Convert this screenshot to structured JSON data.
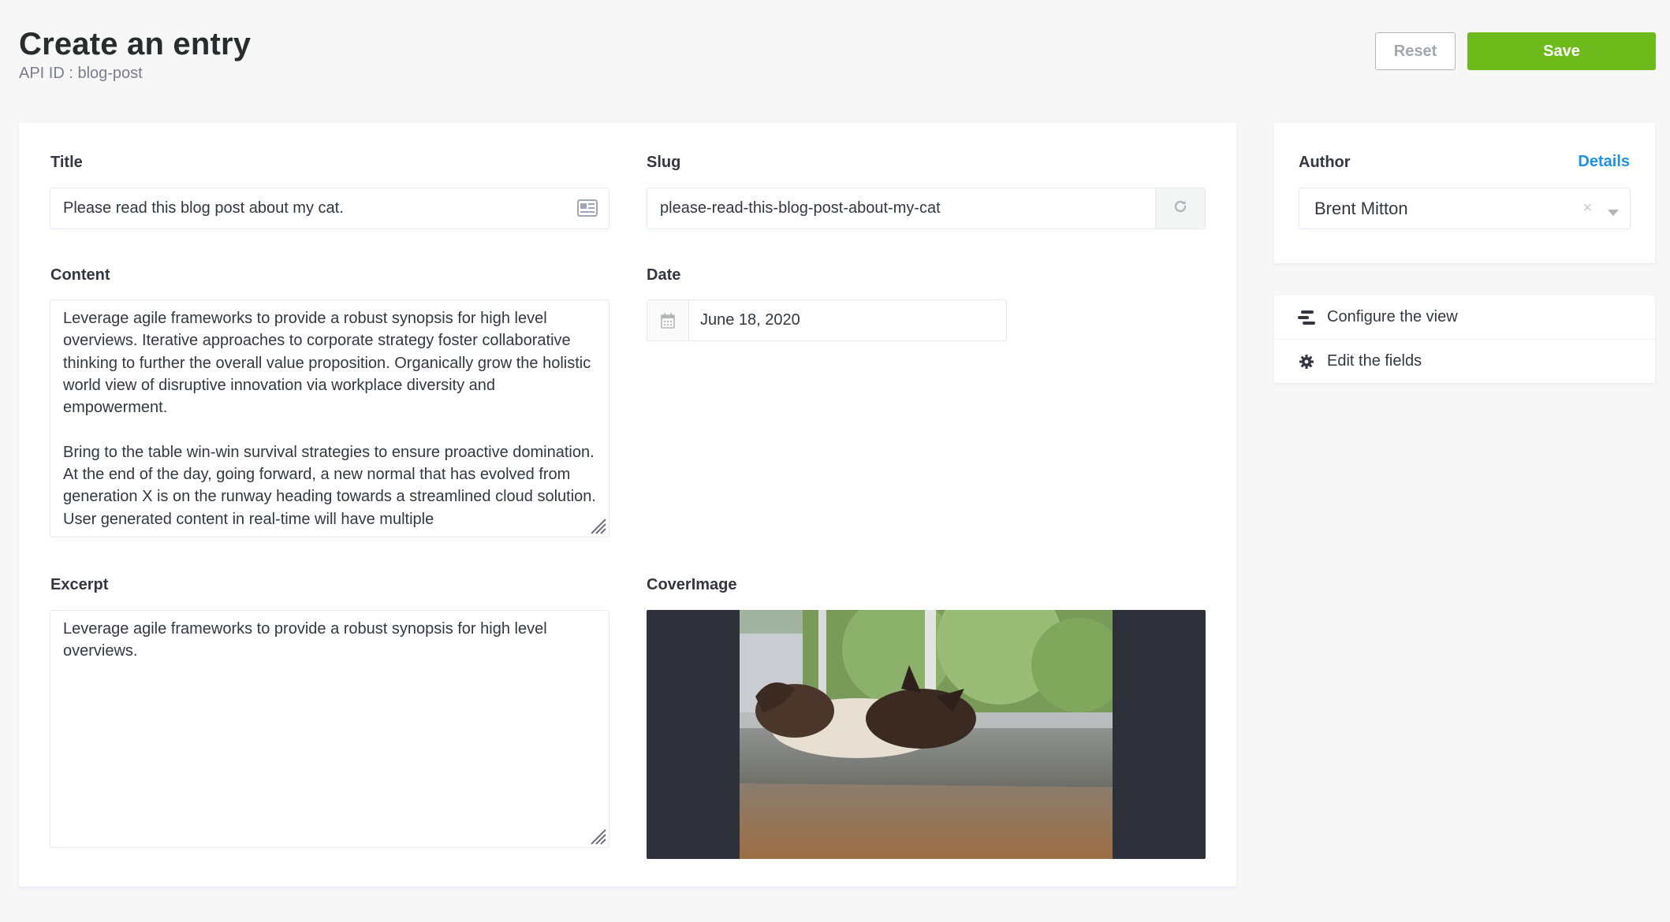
{
  "header": {
    "title": "Create an entry",
    "subtitle": "API ID : blog-post",
    "reset_label": "Reset",
    "save_label": "Save"
  },
  "form": {
    "title": {
      "label": "Title",
      "value": "Please read this blog post about my cat."
    },
    "slug": {
      "label": "Slug",
      "value": "please-read-this-blog-post-about-my-cat"
    },
    "content": {
      "label": "Content",
      "paragraphs": [
        "Leverage agile frameworks to provide a robust synopsis for high level overviews. Iterative approaches to corporate strategy foster collaborative thinking to further the overall value proposition. Organically grow the holistic world view of disruptive innovation via workplace diversity and empowerment.",
        "Bring to the table win-win survival strategies to ensure proactive domination. At the end of the day, going forward, a new normal that has evolved from generation X is on the runway heading towards a streamlined cloud solution. User generated content in real-time will have multiple"
      ]
    },
    "date": {
      "label": "Date",
      "value": "June 18, 2020"
    },
    "excerpt": {
      "label": "Excerpt",
      "value": "Leverage agile frameworks to provide a robust synopsis for high level overviews."
    },
    "cover_image": {
      "label": "CoverImage",
      "alt": "cat-photo"
    }
  },
  "sidebar": {
    "author": {
      "label": "Author",
      "details_link": "Details",
      "value": "Brent Mitton"
    },
    "links": [
      {
        "label": "Configure the view",
        "icon": "layout-icon"
      },
      {
        "label": "Edit the fields",
        "icon": "gear-icon"
      }
    ]
  },
  "colors": {
    "accent_green": "#6dbb1a",
    "link_blue": "#1c91e7",
    "border": "#e3e9f3",
    "background": "#f7f7f7"
  }
}
